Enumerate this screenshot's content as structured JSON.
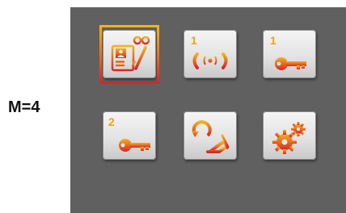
{
  "mode_label": "M=4",
  "colors": {
    "panel_bg": "#606061",
    "accent_gradient_top": "#f6b21a",
    "accent_gradient_bottom": "#d8242b"
  },
  "menu": {
    "selected_index": 0,
    "tiles": [
      {
        "icon": "video-intercom-icon",
        "number": ""
      },
      {
        "icon": "call-handset-1-icon",
        "number": "1"
      },
      {
        "icon": "key-1-icon",
        "number": "1"
      },
      {
        "icon": "key-2-icon",
        "number": "2"
      },
      {
        "icon": "call-forward-icon",
        "number": ""
      },
      {
        "icon": "settings-gear-icon",
        "number": ""
      }
    ]
  }
}
